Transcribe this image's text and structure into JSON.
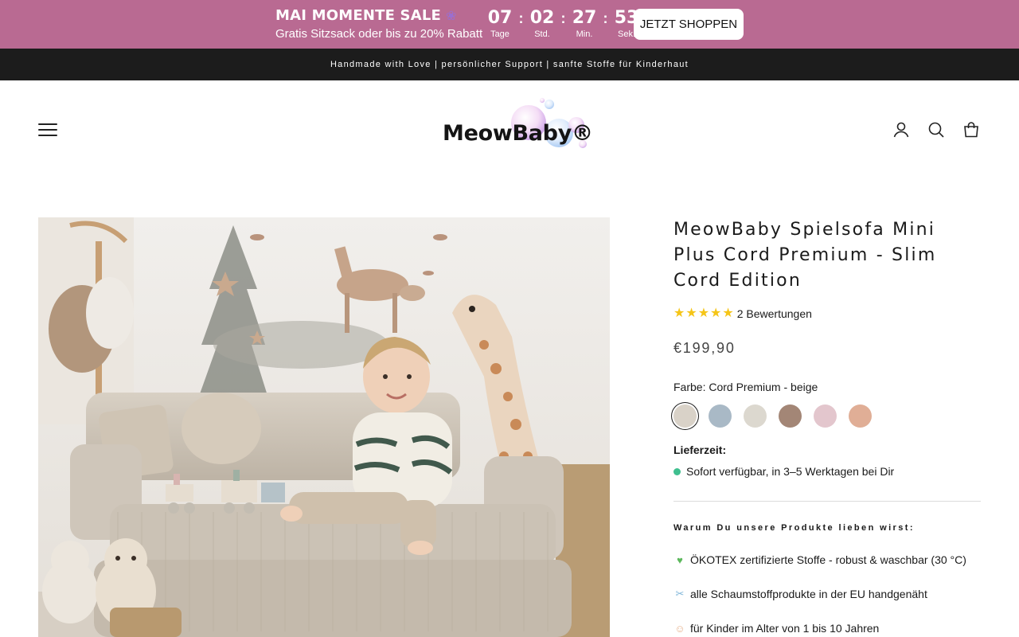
{
  "sale_banner": {
    "title": "MAI MOMENTE SALE",
    "subtitle": "Gratis Sitzsack oder bis zu 20% Rabatt",
    "countdown": [
      {
        "value": "07",
        "label": "Tage"
      },
      {
        "value": "02",
        "label": "Std."
      },
      {
        "value": "27",
        "label": "Min."
      },
      {
        "value": "53",
        "label": "Sek."
      }
    ],
    "separator": ":",
    "cta": "JETZT SHOPPEN",
    "color": "#b96a92"
  },
  "info_bar": {
    "text": "Handmade with Love | persönlicher Support | sanfte Stoffe für Kinderhaut"
  },
  "header": {
    "logo_text": "MeowBaby®",
    "icons": [
      "menu-icon",
      "account-icon",
      "search-icon",
      "cart-icon"
    ]
  },
  "product": {
    "title": "MeowBaby Spielsofa Mini Plus Cord Premium - Slim Cord Edition",
    "rating": {
      "stars": 5,
      "reviews_label": "2 Bewertungen"
    },
    "price": "€199,90",
    "color_label": "Farbe: Cord Premium - beige",
    "swatches": [
      {
        "color": "#d9d2c8",
        "selected": true
      },
      {
        "color": "#a9b9c6",
        "selected": false
      },
      {
        "color": "#dcd8cf",
        "selected": false
      },
      {
        "color": "#a38676",
        "selected": false
      },
      {
        "color": "#e3c6cd",
        "selected": false
      },
      {
        "color": "#e0ae96",
        "selected": false
      }
    ],
    "delivery_label": "Lieferzeit:",
    "delivery_status": "Sofort verfügbar, in 3–5 Werktagen bei Dir",
    "why_title": "Warum Du unsere Produkte lieben wirst:",
    "features": [
      {
        "icon": "green-heart-icon",
        "text": "ÖKOTEX zertifizierte Stoffe - robust & waschbar (30 °C)"
      },
      {
        "icon": "thread-icon",
        "text": "alle Schaumstoffprodukte in der EU handgenäht"
      },
      {
        "icon": "baby-icon",
        "text": "für Kinder im Alter von 1 bis 10 Jahren"
      }
    ]
  }
}
